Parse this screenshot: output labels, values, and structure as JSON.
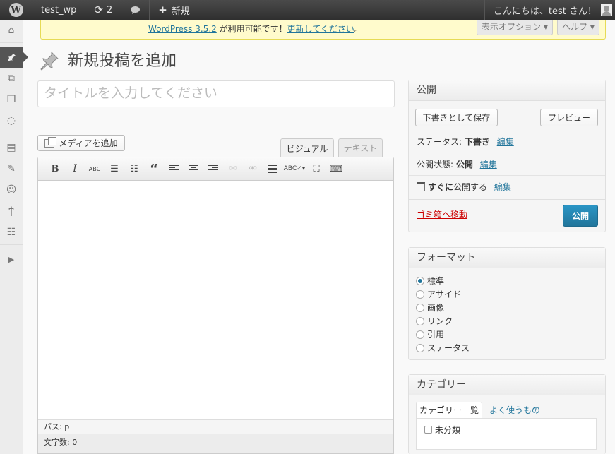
{
  "adminbar": {
    "site_name": "test_wp",
    "updates_count": "2",
    "new_label": "新規",
    "greeting": "こんにちは、test さん！"
  },
  "notice": {
    "link_version": "WordPress 3.5.2",
    "middle": " が利用可能です！",
    "link_update": "更新してください",
    "end": "。"
  },
  "screen_options": "表示オプション ▾",
  "help": "ヘルプ ▾",
  "page_title": "新規投稿を追加",
  "title_placeholder": "タイトルを入力してください",
  "editor": {
    "media_button": "メディアを追加",
    "tab_visual": "ビジュアル",
    "tab_text": "テキスト",
    "toolbar": {
      "bold": "B",
      "italic": "I",
      "strike": "ABC",
      "blockquote": "“"
    },
    "path": "パス: p",
    "wordcount": "文字数: 0"
  },
  "publish": {
    "title": "公開",
    "save_draft": "下書きとして保存",
    "preview": "プレビュー",
    "status_label": "ステータス: ",
    "status_value": "下書き",
    "visibility_label": "公開状態: ",
    "visibility_value": "公開",
    "schedule_bold": "すぐに",
    "schedule_rest": "公開する",
    "edit": "編集",
    "trash": "ゴミ箱へ移動",
    "publish_button": "公開"
  },
  "format": {
    "title": "フォーマット",
    "options": [
      "標準",
      "アサイド",
      "画像",
      "リンク",
      "引用",
      "ステータス"
    ],
    "selected": "標準"
  },
  "category": {
    "title": "カテゴリー",
    "tab_all": "カテゴリー一覧",
    "tab_popular": "よく使うもの",
    "items": [
      "未分類"
    ]
  },
  "colors": {
    "accent": "#21759b",
    "publish_button": "#2a95c5",
    "trash": "#cc0000",
    "notice_bg": "#fffbcc"
  }
}
